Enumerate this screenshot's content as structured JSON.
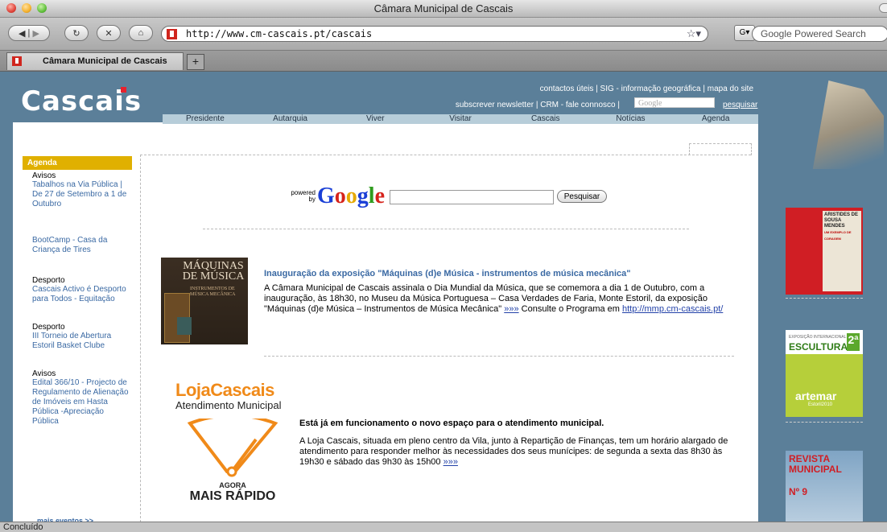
{
  "window": {
    "title": "Câmara Municipal de Cascais"
  },
  "toolbar": {
    "url": "http://www.cm-cascais.pt/cascais",
    "search_placeholder": "Google Powered Search"
  },
  "tab": {
    "label": "Câmara Municipal de Cascais"
  },
  "status": "Concluído",
  "header": {
    "logo": "Cascais",
    "links_row1": "contactos úteis | SIG - informação geográfica | mapa do site",
    "links_row2": "subscrever newsletter | CRM - fale connosco |",
    "google_placeholder": "Google",
    "search_link": "pesquisar"
  },
  "menu": [
    "Presidente",
    "Autarquia",
    "Viver",
    "Visitar",
    "Cascais",
    "Notícias",
    "Agenda"
  ],
  "sidebar": {
    "heading": "Agenda",
    "events": [
      {
        "category": "Avisos",
        "title": "Tabalhos na Via Pública | De 27 de Setembro a 1 de Outubro"
      },
      {
        "category": "",
        "title": "BootCamp - Casa da Criança de Tires"
      },
      {
        "category": "Desporto",
        "title": "Cascais Activo é Desporto para Todos - Equitação"
      },
      {
        "category": "Desporto",
        "title": "III Torneio de Abertura Estoril Basket Clube"
      },
      {
        "category": "Avisos",
        "title": "Edital 366/10 - Projecto de Regulamento de Alienação de Imóveis em Hasta Pública -Apreciação Pública"
      }
    ],
    "more": "mais eventos >>"
  },
  "google": {
    "powered_by": "powered by",
    "logo": "Google",
    "button": "Pesquisar"
  },
  "news": [
    {
      "image_text": "MÁQUINAS DE MÚSICA",
      "image_subtext": "INSTRUMENTOS DE MÚSICA MECÂNICA",
      "title": "Inauguração da exposição \"Máquinas (d)e Música - instrumentos de música mecânica\"",
      "body": "A Câmara Municipal de Cascais assinala o Dia Mundial da Música, que se comemora a dia 1 de Outubro, com a inauguração, às 18h30, no Museu da Música Portuguesa – Casa Verdades de Faria, Monte Estoril, da exposição \"Máquinas (d)e Música – Instrumentos de Música Mecânica\"",
      "more": "»»»",
      "consult": "Consulte o Programa em",
      "link": "http://mmp.cm-cascais.pt/"
    },
    {
      "logo_line1": "LojaCascais",
      "logo_line2": "Atendimento Municipal",
      "agora": "AGORA",
      "rapido": "MAIS RÁPIDO",
      "title": "Está já em funcionamento o novo espaço para o atendimento municipal.",
      "body": "A Loja Cascais, situada em pleno centro da Vila, junto à Repartição de Finanças, tem um horário alargado de atendimento para responder melhor às necessidades dos seus munícipes: de segunda a sexta das 8h30 às 19h30 e sábado das 9h30 às 15h00",
      "more": "»»»"
    }
  ],
  "banners": [
    {
      "title": "ARISTIDES DE SOUSA MENDES",
      "subtitle": "UM EXEMPLO DE CORAGEM"
    },
    {
      "small": "EXPOSIÇÃO INTERNACIONAL DE",
      "title": "ESCULTURA",
      "num": "2ª",
      "brand": "artemar",
      "year": "Estoril2010"
    },
    {
      "title": "REVISTA MUNICIPAL",
      "num": "Nº 9"
    }
  ]
}
